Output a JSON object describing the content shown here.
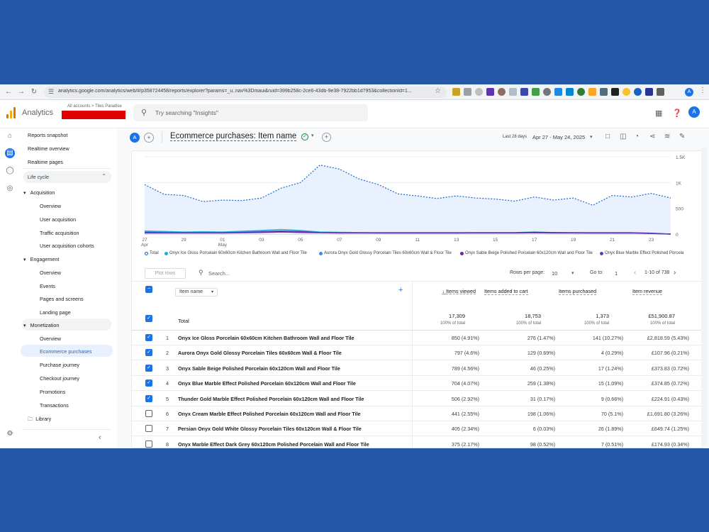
{
  "browser": {
    "url": "analytics.google.com/analytics/web/#/p358724458/reports/explorer?params=_u..nav%3Dmaui&ruid=399b258c-2ce6-43db-9e38-7922bb1d7953&collectionId=1..."
  },
  "header": {
    "app_title": "Analytics",
    "breadcrumb": "All accounts > Tiles Paradise",
    "search_placeholder": "Try searching \"Insights\"",
    "avatar_letter": "A"
  },
  "sidebar": {
    "items": [
      {
        "label": "Reports snapshot"
      },
      {
        "label": "Realtime overview"
      },
      {
        "label": "Realtime pages"
      }
    ],
    "lifecycle_label": "Life cycle",
    "groups": [
      {
        "label": "Acquisition",
        "children": [
          "Overview",
          "User acquisition",
          "Traffic acquisition",
          "User acquisition cohorts"
        ]
      },
      {
        "label": "Engagement",
        "children": [
          "Overview",
          "Events",
          "Pages and screens",
          "Landing page"
        ]
      },
      {
        "label": "Monetization",
        "children": [
          "Overview",
          "Ecommerce purchases",
          "Purchase journey",
          "Checkout journey",
          "Promotions",
          "Transactions"
        ]
      }
    ],
    "library_label": "Library"
  },
  "toolbar": {
    "segment_letter": "A",
    "report_title": "Ecommerce purchases: Item name",
    "date_prefix": "Last 28 days",
    "date_range": "Apr 27 - May 24, 2025"
  },
  "chart_data": {
    "type": "line",
    "x": [
      "Apr 27",
      "Apr 28",
      "Apr 29",
      "Apr 30",
      "May 01",
      "May 02",
      "May 03",
      "May 04",
      "May 05",
      "May 06",
      "May 07",
      "May 08",
      "May 09",
      "May 10",
      "May 11",
      "May 12",
      "May 13",
      "May 14",
      "May 15",
      "May 16",
      "May 17",
      "May 18",
      "May 19",
      "May 20",
      "May 21",
      "May 22",
      "May 23",
      "May 24"
    ],
    "x_tick_labels": [
      "27\nApr",
      "29",
      "01\nMay",
      "03",
      "05",
      "07",
      "09",
      "11",
      "13",
      "15",
      "17",
      "19",
      "21",
      "23"
    ],
    "y_tick_labels": [
      "1.5K",
      "1K",
      "500",
      "0"
    ],
    "ylim": [
      0,
      1500
    ],
    "series": [
      {
        "name": "Total",
        "color": "#1967d2",
        "values": [
          960,
          770,
          750,
          630,
          660,
          650,
          700,
          890,
          1000,
          1340,
          1260,
          1070,
          960,
          780,
          740,
          690,
          740,
          700,
          680,
          640,
          720,
          660,
          700,
          560,
          750,
          720,
          790,
          700
        ]
      },
      {
        "name": "Onyx Ice Gloss Porcelain 60x60cm Kitchen Bathroom Wall and Floor Tile",
        "color": "#12b5cb",
        "values": [
          60,
          50,
          40,
          45,
          40,
          55,
          70,
          90,
          70,
          40,
          35,
          30,
          30,
          30,
          30,
          30,
          30,
          30,
          30,
          30,
          40,
          30,
          30,
          30,
          30,
          30,
          20,
          0
        ]
      },
      {
        "name": "Aurora Onyx Gold Glossy Porcelain Tiles 60x60cm Wall & Floor Tile",
        "color": "#4285f4",
        "values": [
          40,
          35,
          30,
          30,
          30,
          40,
          50,
          60,
          50,
          30,
          25,
          25,
          25,
          25,
          25,
          25,
          25,
          25,
          25,
          25,
          30,
          25,
          25,
          25,
          25,
          25,
          15,
          0
        ]
      },
      {
        "name": "Onyx Sable Beige Polished Porcelain 60x120cm Wall and Floor Tile",
        "color": "#7b1fa2",
        "values": [
          30,
          25,
          25,
          25,
          25,
          30,
          40,
          60,
          45,
          30,
          25,
          25,
          20,
          20,
          20,
          20,
          20,
          25,
          25,
          25,
          35,
          30,
          25,
          20,
          20,
          20,
          15,
          0
        ]
      },
      {
        "name": "Onyx Blue Marble Effect Polished Porcelain 60x120cm Wall and Floor Tile",
        "color": "#673ab7",
        "values": [
          20,
          20,
          20,
          20,
          20,
          25,
          30,
          40,
          30,
          25,
          20,
          20,
          20,
          20,
          20,
          20,
          20,
          20,
          20,
          20,
          25,
          20,
          20,
          20,
          20,
          20,
          10,
          0
        ]
      }
    ]
  },
  "legend_labels": [
    "Total",
    "Onyx Ice Gloss Porcelain 60x60cm Kitchen Bathroom Wall and Floor Tile",
    "Aurora Onyx Gold Glossy Porcelain Tiles 60x60cm Wall & Floor Tile",
    "Onyx Sable Beige Polished Porcelain 60x120cm Wall and Floor Tile",
    "Onyx Blue Marble Effect Polished Porcela"
  ],
  "table_controls": {
    "plot_rows": "Plot rows",
    "search_placeholder": "Search...",
    "rows_per_page_label": "Rows per page:",
    "rows_per_page": "10",
    "goto_label": "Go to:",
    "goto_value": "1",
    "pagination": "1-10 of 738"
  },
  "table": {
    "dimension": "Item name",
    "columns": [
      "Items viewed",
      "Items added to cart",
      "Items purchased",
      "Item revenue"
    ],
    "total_label": "Total",
    "totals": [
      {
        "value": "17,309",
        "sub": "100% of total"
      },
      {
        "value": "18,753",
        "sub": "100% of total"
      },
      {
        "value": "1,373",
        "sub": "100% of total"
      },
      {
        "value": "£51,900.87",
        "sub": "100% of total"
      }
    ],
    "rows": [
      {
        "idx": "1",
        "checked": true,
        "name": "Onyx Ice Gloss Porcelain 60x60cm Kitchen Bathroom Wall and Floor Tile",
        "viewed": "850 (4.91%)",
        "added": "276 (1.47%)",
        "purchased": "141 (10.27%)",
        "revenue": "£2,818.59 (5.43%)"
      },
      {
        "idx": "2",
        "checked": true,
        "name": "Aurora Onyx Gold Glossy Porcelain Tiles 60x60cm Wall & Floor Tile",
        "viewed": "797 (4.6%)",
        "added": "129 (0.69%)",
        "purchased": "4 (0.29%)",
        "revenue": "£107.96 (0.21%)"
      },
      {
        "idx": "3",
        "checked": true,
        "name": "Onyx Sable Beige Polished Porcelain 60x120cm Wall and Floor Tile",
        "viewed": "789 (4.56%)",
        "added": "46 (0.25%)",
        "purchased": "17 (1.24%)",
        "revenue": "£373.83 (0.72%)"
      },
      {
        "idx": "4",
        "checked": true,
        "name": "Onyx Blue Marble Effect Polished Porcelain 60x120cm Wall and Floor Tile",
        "viewed": "704 (4.07%)",
        "added": "259 (1.38%)",
        "purchased": "15 (1.09%)",
        "revenue": "£374.85 (0.72%)"
      },
      {
        "idx": "5",
        "checked": true,
        "name": "Thunder Gold Marble Effect Polished Porcelain 60x120cm Wall and Floor Tile",
        "viewed": "506 (2.92%)",
        "added": "31 (0.17%)",
        "purchased": "9 (0.66%)",
        "revenue": "£224.91 (0.43%)"
      },
      {
        "idx": "6",
        "checked": false,
        "name": "Onyx Cream Marble Effect Polished Porcelain 60x120cm Wall and Floor Tile",
        "viewed": "441 (2.55%)",
        "added": "198 (1.06%)",
        "purchased": "70 (5.1%)",
        "revenue": "£1,691.80 (3.26%)"
      },
      {
        "idx": "7",
        "checked": false,
        "name": "Persian Onyx Gold White Glossy Porcelain Tiles 60x120cm Wall & Floor Tile",
        "viewed": "405 (2.34%)",
        "added": "6 (0.03%)",
        "purchased": "26 (1.89%)",
        "revenue": "£649.74 (1.25%)"
      },
      {
        "idx": "8",
        "checked": false,
        "name": "Onyx Marble Effect Dark Grey 60x120cm Polished Porcelain Wall and Floor Tile",
        "viewed": "375 (2.17%)",
        "added": "98 (0.52%)",
        "purchased": "7 (0.51%)",
        "revenue": "£174.93 (0.34%)"
      }
    ]
  }
}
